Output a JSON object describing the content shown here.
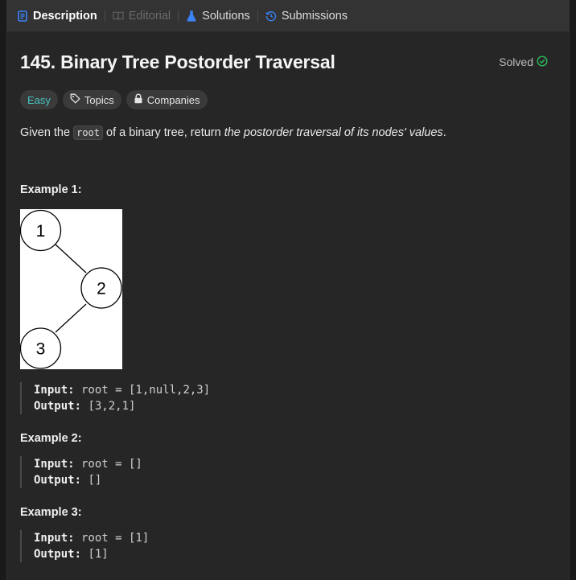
{
  "tabs": [
    {
      "label": "Description",
      "icon": "description-icon",
      "state": "active"
    },
    {
      "label": "Editorial",
      "icon": "editorial-icon",
      "state": "disabled"
    },
    {
      "label": "Solutions",
      "icon": "flask-icon",
      "state": "normal"
    },
    {
      "label": "Submissions",
      "icon": "history-icon",
      "state": "normal"
    }
  ],
  "problem": {
    "title": "145. Binary Tree Postorder Traversal",
    "status": "Solved",
    "difficulty": "Easy",
    "topics_label": "Topics",
    "companies_label": "Companies",
    "desc_pre": "Given the ",
    "desc_code": "root",
    "desc_mid": " of a binary tree, return ",
    "desc_em": "the postorder traversal of its nodes' values",
    "desc_post": "."
  },
  "examples": [
    {
      "title": "Example 1:",
      "tree_nodes": [
        "1",
        "2",
        "3"
      ],
      "input_label": "Input:",
      "input_value": " root = [1,null,2,3]",
      "output_label": "Output:",
      "output_value": " [3,2,1]"
    },
    {
      "title": "Example 2:",
      "input_label": "Input:",
      "input_value": " root = []",
      "output_label": "Output:",
      "output_value": " []"
    },
    {
      "title": "Example 3:",
      "input_label": "Input:",
      "input_value": " root = [1]",
      "output_label": "Output:",
      "output_value": " [1]"
    }
  ],
  "colors": {
    "accent_blue": "#3b82f6",
    "easy": "#46c6c2",
    "solved_check": "#2cbb5d"
  }
}
